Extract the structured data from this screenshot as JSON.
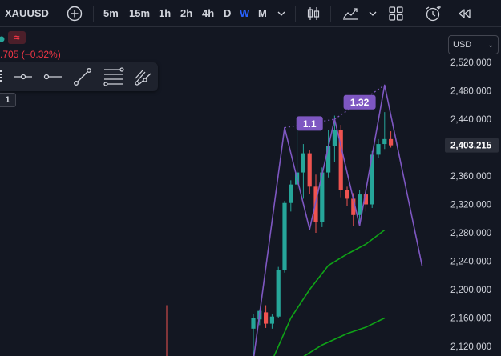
{
  "toolbar": {
    "symbol": "XAUUSD",
    "intervals": [
      "5m",
      "15m",
      "1h",
      "2h",
      "4h",
      "D",
      "W",
      "M"
    ],
    "active_interval": "W",
    "icons": [
      "add-symbol-icon",
      "chevron-down-icon",
      "candles-icon",
      "indicators-icon",
      "chevron-down-icon",
      "layout-icon",
      "alert-clock-icon",
      "replay-icon"
    ]
  },
  "legend": {
    "change": ".705 (−0.32%)",
    "change_color": "#f23645",
    "wave_glyph": "≈"
  },
  "drawing_toolbar": {
    "icons": [
      "drag-handle-icon",
      "horizontal-ray-icon",
      "horizontal-line-icon",
      "trend-line-icon",
      "fib-retracement-icon",
      "pitchfork-icon"
    ],
    "badge": "1"
  },
  "price_axis": {
    "currency": "USD",
    "current_price": "2,403.215"
  },
  "colors": {
    "background": "#131722",
    "up": "#26a69a",
    "down": "#ef5350",
    "pattern": "#7e57c2",
    "ma": "#0fa317"
  },
  "chart_data": {
    "type": "candlestick",
    "y_axis": {
      "range": [
        2100,
        2545
      ],
      "ticks": [
        2520,
        2480,
        2440,
        2400,
        2360,
        2320,
        2280,
        2240,
        2200,
        2160,
        2120
      ],
      "tick_labels": [
        "2,520.000",
        "2,480.000",
        "2,440.000",
        "2,400.000",
        "2,360.000",
        "2,320.000",
        "2,280.000",
        "2,240.000",
        "2,200.000",
        "2,160.000",
        "2,120.000"
      ]
    },
    "candles": [
      {
        "o": 2145,
        "h": 2166,
        "l": 2080,
        "c": 2160
      },
      {
        "o": 2158,
        "h": 2172,
        "l": 2150,
        "c": 2170
      },
      {
        "o": 2168,
        "h": 2178,
        "l": 2146,
        "c": 2152
      },
      {
        "o": 2152,
        "h": 2165,
        "l": 2145,
        "c": 2162
      },
      {
        "o": 2162,
        "h": 2232,
        "l": 2160,
        "c": 2228
      },
      {
        "o": 2228,
        "h": 2325,
        "l": 2224,
        "c": 2322
      },
      {
        "o": 2322,
        "h": 2354,
        "l": 2310,
        "c": 2348
      },
      {
        "o": 2348,
        "h": 2432,
        "l": 2342,
        "c": 2365
      },
      {
        "o": 2365,
        "h": 2405,
        "l": 2328,
        "c": 2392
      },
      {
        "o": 2392,
        "h": 2396,
        "l": 2335,
        "c": 2345
      },
      {
        "o": 2345,
        "h": 2362,
        "l": 2280,
        "c": 2295
      },
      {
        "o": 2295,
        "h": 2372,
        "l": 2288,
        "c": 2365
      },
      {
        "o": 2365,
        "h": 2425,
        "l": 2358,
        "c": 2402
      },
      {
        "o": 2402,
        "h": 2445,
        "l": 2380,
        "c": 2425
      },
      {
        "o": 2425,
        "h": 2432,
        "l": 2330,
        "c": 2340
      },
      {
        "o": 2340,
        "h": 2345,
        "l": 2318,
        "c": 2328
      },
      {
        "o": 2328,
        "h": 2336,
        "l": 2290,
        "c": 2305
      },
      {
        "o": 2305,
        "h": 2340,
        "l": 2290,
        "c": 2334
      },
      {
        "o": 2334,
        "h": 2342,
        "l": 2310,
        "c": 2320
      },
      {
        "o": 2320,
        "h": 2395,
        "l": 2315,
        "c": 2390
      },
      {
        "o": 2390,
        "h": 2412,
        "l": 2385,
        "c": 2405
      },
      {
        "o": 2405,
        "h": 2450,
        "l": 2398,
        "c": 2412
      },
      {
        "o": 2412,
        "h": 2423,
        "l": 2400,
        "c": 2403.215
      }
    ],
    "pattern_line": {
      "points": [
        [
          0,
          2100
        ],
        [
          5,
          2428
        ],
        [
          9,
          2285
        ],
        [
          13,
          2440
        ],
        [
          17,
          2290
        ],
        [
          21,
          2488
        ],
        [
          27,
          2233
        ]
      ]
    },
    "pattern_labels": [
      {
        "text": "1.1",
        "from": [
          5,
          2428
        ],
        "to": [
          13,
          2440
        ]
      },
      {
        "text": "1.32",
        "from": [
          13,
          2440
        ],
        "to": [
          21,
          2488
        ]
      }
    ],
    "moving_averages": [
      {
        "points": [
          [
            3,
            2100
          ],
          [
            6,
            2160
          ],
          [
            9,
            2200
          ],
          [
            12,
            2234
          ],
          [
            15,
            2250
          ],
          [
            18,
            2264
          ],
          [
            21,
            2284
          ]
        ]
      },
      {
        "points": [
          [
            7,
            2100
          ],
          [
            11,
            2122
          ],
          [
            15,
            2138
          ],
          [
            18,
            2147
          ],
          [
            21,
            2160
          ]
        ]
      }
    ]
  }
}
